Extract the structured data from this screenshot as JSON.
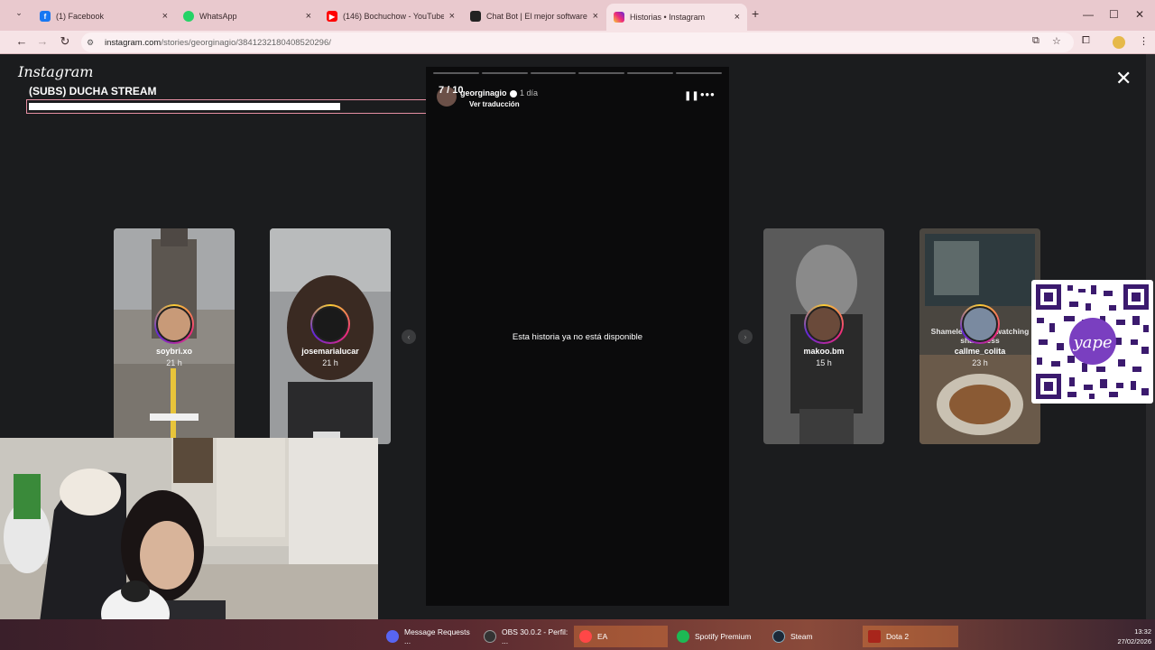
{
  "browser": {
    "tabs": [
      {
        "title": "(1) Facebook",
        "icon": "facebook-icon",
        "color": "#1877f2"
      },
      {
        "title": "WhatsApp",
        "icon": "whatsapp-icon",
        "color": "#25d366"
      },
      {
        "title": "(146) Bochuchow - YouTube",
        "icon": "youtube-icon",
        "color": "#ff0000"
      },
      {
        "title": "Chat Bot | El mejor software pa",
        "icon": "chatbot-icon",
        "color": "#222222"
      },
      {
        "title": "Historias • Instagram",
        "icon": "instagram-icon",
        "color": "#e1306c"
      }
    ],
    "url_host": "instagram.com",
    "url_path": "/stories/georginagio/3841232180408520296/"
  },
  "instagram": {
    "logo": "Instagram",
    "stream_title": "(SUBS) DUCHA STREAM",
    "stream_progress": 0.7,
    "story": {
      "counter": "7 / 10",
      "username": "georginagio",
      "time": "1 día",
      "translate_label": "Ver traducción",
      "unavailable_text": "Esta historia ya no está disponible",
      "segments_total": 6,
      "segments_done": 0
    },
    "cards": [
      {
        "username": "soybri.xo",
        "time": "21 h",
        "bg": "#6e6a64"
      },
      {
        "username": "josemarialucar",
        "time": "21 h",
        "bg": "#3e3c3a"
      },
      {
        "username": "makoo.bm",
        "time": "15 h",
        "bg": "#4a4a4a"
      },
      {
        "username": "callme_colita",
        "time": "23 h",
        "bg": "#3a3630",
        "overlay_text": "Shameless binge watching shameless"
      }
    ]
  },
  "taskbar": {
    "items": [
      {
        "label": "Message Requests ...",
        "color": "#5865f2"
      },
      {
        "label": "OBS 30.0.2 - Perfil: ...",
        "color": "#333333"
      },
      {
        "label": "EA",
        "color": "#ff4747"
      },
      {
        "label": "Spotify Premium",
        "color": "#1db954"
      },
      {
        "label": "Steam",
        "color": "#1b2838"
      },
      {
        "label": "Dota 2",
        "color": "#a8251b"
      }
    ],
    "time": "13:32",
    "date": "27/02/2026"
  }
}
